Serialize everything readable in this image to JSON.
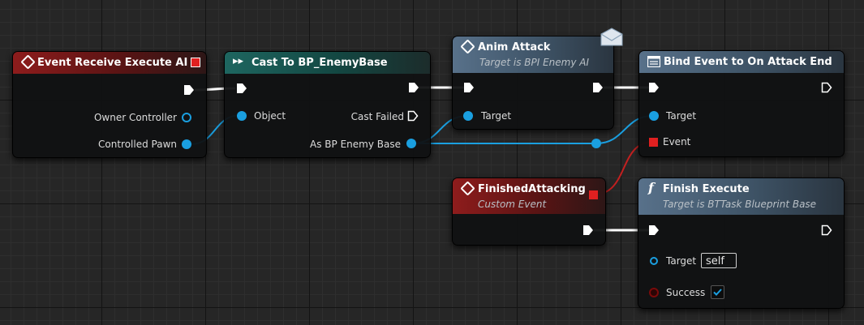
{
  "nodes": {
    "event_receive": {
      "title": "Event Receive Execute AI",
      "pins": {
        "owner_controller": "Owner Controller",
        "controlled_pawn": "Controlled Pawn"
      }
    },
    "cast": {
      "title": "Cast To BP_EnemyBase",
      "pins": {
        "object": "Object",
        "cast_failed": "Cast Failed",
        "as_bp": "As BP Enemy Base"
      }
    },
    "anim_attack": {
      "title": "Anim Attack",
      "subtitle": "Target is BPI Enemy AI",
      "pins": {
        "target": "Target"
      }
    },
    "bind_event": {
      "title": "Bind Event to On Attack End",
      "pins": {
        "target": "Target",
        "event": "Event"
      }
    },
    "finished_attacking": {
      "title": "FinishedAttacking",
      "subtitle": "Custom Event"
    },
    "finish_execute": {
      "title": "Finish Execute",
      "subtitle": "Target is BTTask Blueprint Base",
      "pins": {
        "target": "Target",
        "target_value": "self",
        "success": "Success"
      },
      "success_checked": true
    }
  },
  "colors": {
    "exec_wire": "#ffffff",
    "object_pin": "#1a9fe0",
    "delegate_pin": "#e02020",
    "bool_pin": "#8a0a0a"
  },
  "icons": {
    "event": "diamond-icon",
    "cast": "cast-arrows-icon",
    "message": "envelope-icon",
    "function": "function-f-icon",
    "check": "checkmark-icon"
  }
}
